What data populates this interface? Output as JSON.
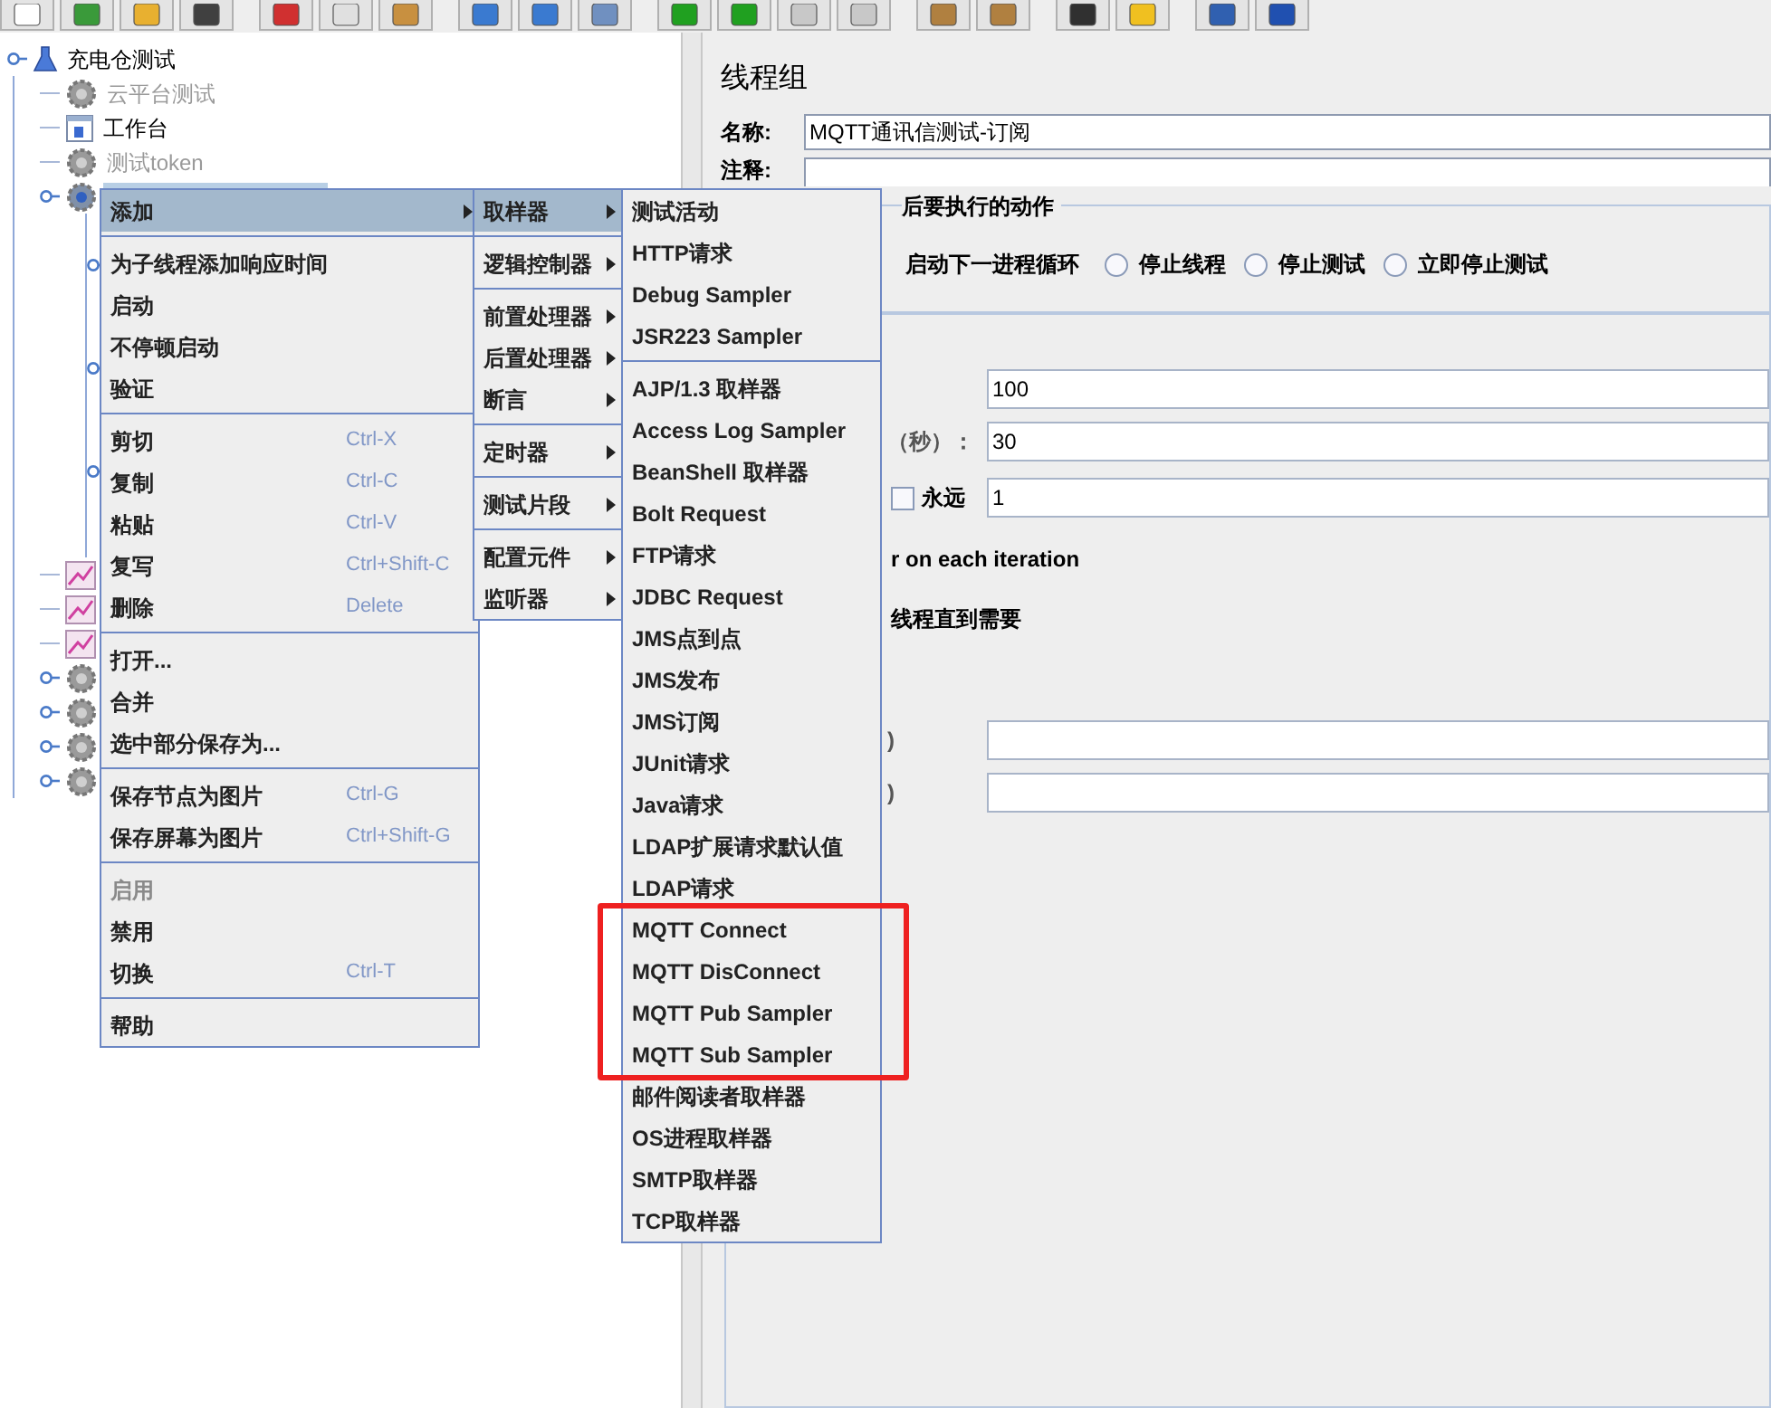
{
  "tree": [
    {
      "label": "充电仓测试",
      "kind": "plan",
      "selected": false,
      "disabled": false,
      "children": [
        {
          "label": "云平台测试",
          "kind": "gear",
          "selected": false,
          "disabled": true
        },
        {
          "label": "工作台",
          "kind": "bench",
          "selected": false,
          "disabled": false
        },
        {
          "label": "测试token",
          "kind": "gear",
          "selected": false,
          "disabled": true
        },
        {
          "kind": "gear-selected",
          "selected": true,
          "disabled": false,
          "children": [
            {
              "collapsed": false
            },
            {
              "collapsed": true
            },
            {
              "collapsed": false
            },
            {
              "collapsed": false
            },
            {
              "collapsed": true
            },
            {
              "collapsed": false
            },
            {
              "collapsed": false
            },
            {
              "collapsed": true
            },
            {
              "collapsed": false
            },
            {
              "collapsed": false
            }
          ]
        },
        {
          "kind": "graph"
        },
        {
          "kind": "graph"
        },
        {
          "kind": "graph"
        },
        {
          "kind": "gear",
          "collapsed": true
        },
        {
          "kind": "gear",
          "collapsed": true
        },
        {
          "kind": "gear",
          "collapsed": true
        },
        {
          "kind": "gear",
          "collapsed": true
        }
      ]
    }
  ],
  "panel": {
    "title": "线程组",
    "name_label": "名称:",
    "name_value": "MQTT通讯信测试-订阅",
    "comment_label": "注释:",
    "action_group": "后要执行的动作",
    "actions": [
      {
        "label": "启动下一进程循环",
        "kind": "covered-radio"
      },
      {
        "label": "停止线程",
        "kind": "radio",
        "selected": false
      },
      {
        "label": "停止测试",
        "kind": "radio",
        "selected": false
      },
      {
        "label": "立即停止测试",
        "kind": "radio",
        "selected": false
      }
    ],
    "rows": [
      {
        "kind": "field",
        "value": "100"
      },
      {
        "kind": "field",
        "label": "（秒）：",
        "value": "30"
      },
      {
        "kind": "loop",
        "label": "永远",
        "checked": false,
        "value": "1"
      },
      {
        "kind": "text",
        "label": "r on each iteration"
      },
      {
        "kind": "text",
        "label": "线程直到需要"
      },
      {
        "kind": "gap"
      },
      {
        "kind": "field",
        "label": ")",
        "value": ""
      },
      {
        "kind": "field",
        "label": ")",
        "value": ""
      }
    ]
  },
  "context_menu": [
    {
      "kind": "item",
      "label": "添加",
      "submenu": true,
      "selected": true
    },
    {
      "kind": "separator"
    },
    {
      "kind": "item",
      "label": "为子线程添加响应时间"
    },
    {
      "kind": "item",
      "label": "启动"
    },
    {
      "kind": "item",
      "label": "不停顿启动"
    },
    {
      "kind": "item",
      "label": "验证"
    },
    {
      "kind": "separator"
    },
    {
      "kind": "item",
      "label": "剪切",
      "shortcut": "Ctrl-X"
    },
    {
      "kind": "item",
      "label": "复制",
      "shortcut": "Ctrl-C"
    },
    {
      "kind": "item",
      "label": "粘贴",
      "shortcut": "Ctrl-V"
    },
    {
      "kind": "item",
      "label": "复写",
      "shortcut": "Ctrl+Shift-C"
    },
    {
      "kind": "item",
      "label": "删除",
      "shortcut": "Delete"
    },
    {
      "kind": "separator"
    },
    {
      "kind": "item",
      "label": "打开..."
    },
    {
      "kind": "item",
      "label": "合并"
    },
    {
      "kind": "item",
      "label": "选中部分保存为..."
    },
    {
      "kind": "separator"
    },
    {
      "kind": "item",
      "label": "保存节点为图片",
      "shortcut": "Ctrl-G"
    },
    {
      "kind": "item",
      "label": "保存屏幕为图片",
      "shortcut": "Ctrl+Shift-G"
    },
    {
      "kind": "separator"
    },
    {
      "kind": "item",
      "label": "启用",
      "disabled": true
    },
    {
      "kind": "item",
      "label": "禁用"
    },
    {
      "kind": "item",
      "label": "切换",
      "shortcut": "Ctrl-T"
    },
    {
      "kind": "separator"
    },
    {
      "kind": "item",
      "label": "帮助"
    }
  ],
  "add_menu": [
    {
      "kind": "item",
      "label": "取样器",
      "submenu": true,
      "selected": true
    },
    {
      "kind": "separator"
    },
    {
      "kind": "item",
      "label": "逻辑控制器",
      "submenu": true
    },
    {
      "kind": "separator"
    },
    {
      "kind": "item",
      "label": "前置处理器",
      "submenu": true
    },
    {
      "kind": "item",
      "label": "后置处理器",
      "submenu": true
    },
    {
      "kind": "item",
      "label": "断言",
      "submenu": true
    },
    {
      "kind": "separator"
    },
    {
      "kind": "item",
      "label": "定时器",
      "submenu": true
    },
    {
      "kind": "separator"
    },
    {
      "kind": "item",
      "label": "测试片段",
      "submenu": true
    },
    {
      "kind": "separator"
    },
    {
      "kind": "item",
      "label": "配置元件",
      "submenu": true
    },
    {
      "kind": "item",
      "label": "监听器",
      "submenu": true
    }
  ],
  "sampler_menu": [
    {
      "kind": "item",
      "label": "测试活动"
    },
    {
      "kind": "item",
      "label": "HTTP请求"
    },
    {
      "kind": "item",
      "label": "Debug Sampler"
    },
    {
      "kind": "item",
      "label": "JSR223 Sampler"
    },
    {
      "kind": "separator"
    },
    {
      "kind": "item",
      "label": "AJP/1.3 取样器"
    },
    {
      "kind": "item",
      "label": "Access Log Sampler"
    },
    {
      "kind": "item",
      "label": "BeanShell 取样器"
    },
    {
      "kind": "item",
      "label": "Bolt Request"
    },
    {
      "kind": "item",
      "label": "FTP请求"
    },
    {
      "kind": "item",
      "label": "JDBC Request"
    },
    {
      "kind": "item",
      "label": "JMS点到点"
    },
    {
      "kind": "item",
      "label": "JMS发布"
    },
    {
      "kind": "item",
      "label": "JMS订阅"
    },
    {
      "kind": "item",
      "label": "JUnit请求"
    },
    {
      "kind": "item",
      "label": "Java请求"
    },
    {
      "kind": "item",
      "label": "LDAP扩展请求默认值"
    },
    {
      "kind": "item",
      "label": "LDAP请求"
    },
    {
      "kind": "item",
      "label": "MQTT Connect",
      "highlighted": true
    },
    {
      "kind": "item",
      "label": "MQTT DisConnect",
      "highlighted": true
    },
    {
      "kind": "item",
      "label": "MQTT Pub Sampler",
      "highlighted": true
    },
    {
      "kind": "item",
      "label": "MQTT Sub Sampler",
      "highlighted": true
    },
    {
      "kind": "item",
      "label": "邮件阅读者取样器"
    },
    {
      "kind": "item",
      "label": "OS进程取样器"
    },
    {
      "kind": "item",
      "label": "SMTP取样器"
    },
    {
      "kind": "item",
      "label": "TCP取样器"
    }
  ]
}
